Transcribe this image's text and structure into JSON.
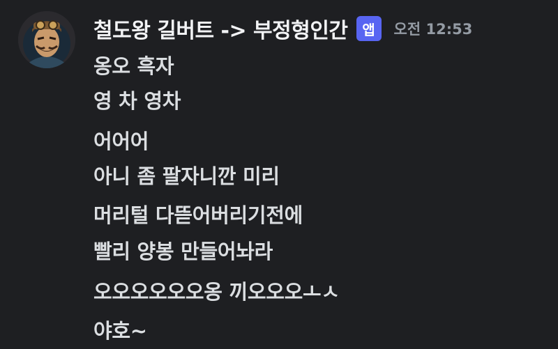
{
  "message": {
    "author": "철도왕 길버트 -> 부정형인간",
    "badge": "앱",
    "timestamp": "오전 12:53",
    "avatar_icon": "cartoon-aviator-avatar",
    "lines": [
      "옹오 흑자",
      "영 차 영차",
      "어어어",
      "아니 좀 팔자니깐 미리",
      "머리털 다뜯어버리기전에",
      "빨리 양봉 만들어놔라",
      "오오오오오오옹 끼오오오ㅗㅅ",
      "야호~"
    ]
  },
  "colors": {
    "background": "#1e1f22",
    "username": "#f2f3f5",
    "text": "#dbdee1",
    "timestamp": "#949ba4",
    "badge": "#5865f2"
  }
}
